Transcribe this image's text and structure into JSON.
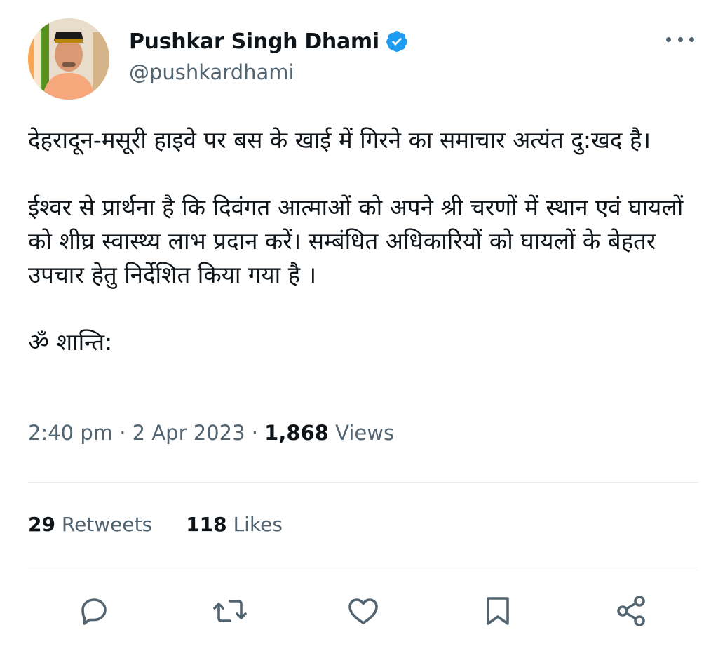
{
  "author": {
    "display_name": "Pushkar Singh Dhami",
    "handle": "@pushkardhami",
    "verified": true
  },
  "tweet": {
    "paragraphs": [
      "देहरादून-मसूरी हाइवे पर बस के खाई में गिरने का समाचार अत्यंत दु:खद है।",
      "ईश्वर से प्रार्थना है कि दिवंगत आत्माओं को अपने श्री चरणों में स्थान एवं घायलों को शीघ्र स्वास्थ्य लाभ प्रदान करें। सम्बंधित अधिकारियों को घायलों के बेहतर उपचार हेतु निर्देशित किया गया है ।",
      "ॐ शान्ति:"
    ]
  },
  "meta": {
    "time": "2:40 pm",
    "separator": "·",
    "date": "2 Apr 2023",
    "views_count": "1,868",
    "views_label": "Views"
  },
  "stats": {
    "retweets_count": "29",
    "retweets_label": "Retweets",
    "likes_count": "118",
    "likes_label": "Likes"
  },
  "icons": {
    "more": "more-options-icon",
    "reply": "reply-icon",
    "retweet": "retweet-icon",
    "like": "like-icon",
    "bookmark": "bookmark-icon",
    "share": "share-icon",
    "verified": "verified-badge-icon"
  },
  "colors": {
    "text_primary": "#0f1419",
    "text_secondary": "#536471",
    "verified_blue": "#1d9bf0",
    "divider": "#e6ecf0"
  }
}
